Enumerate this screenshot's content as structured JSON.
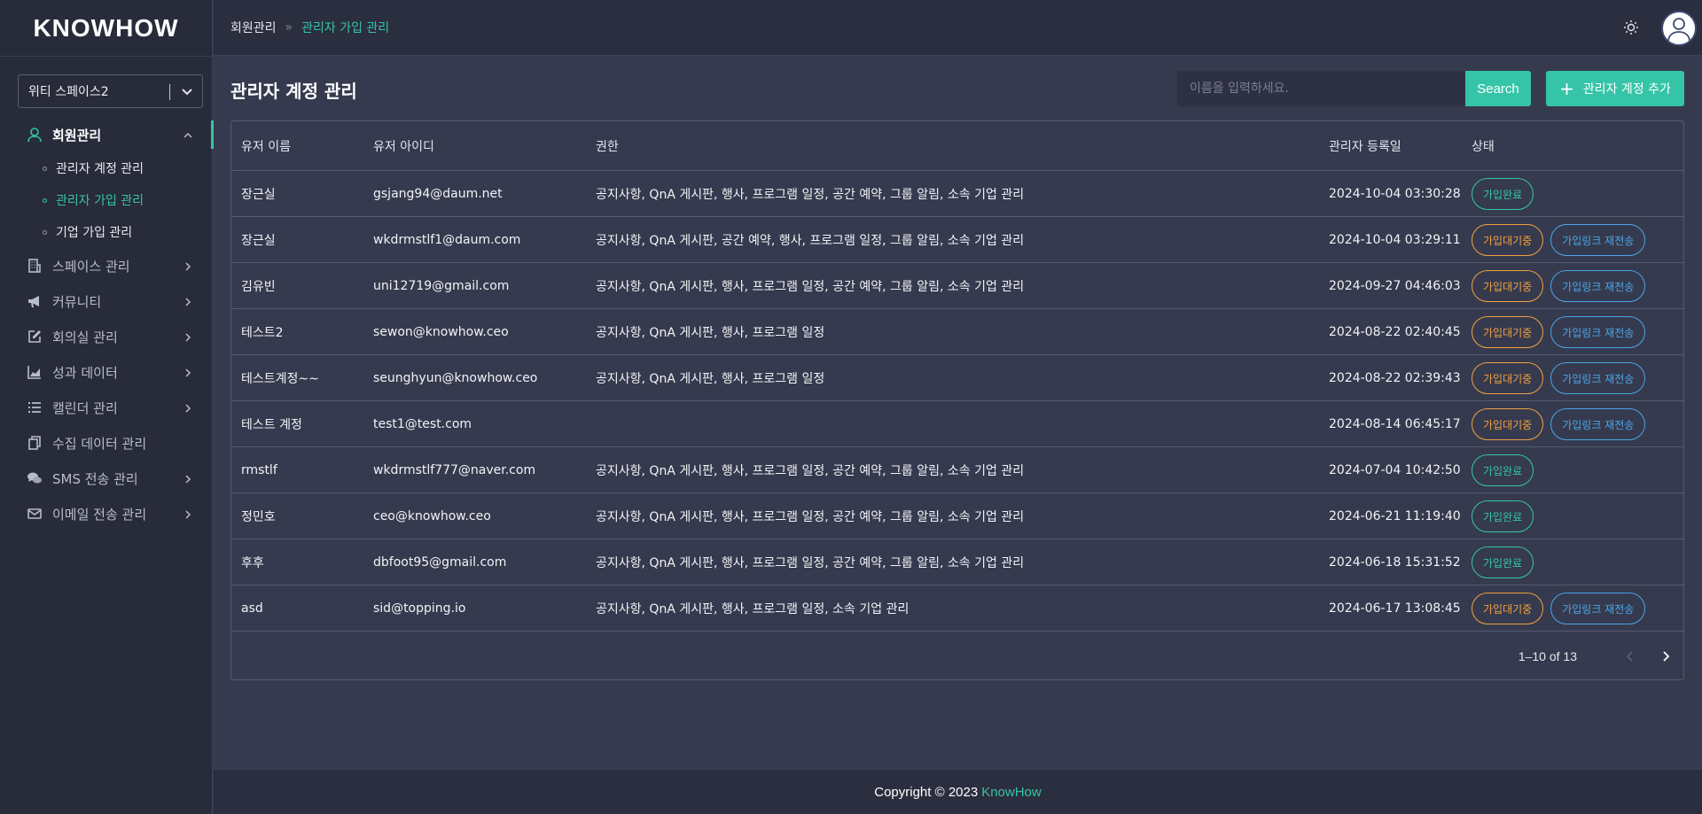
{
  "app": {
    "logo": "KNOWHOW"
  },
  "workspace": {
    "selected": "위티 스페이스2"
  },
  "sidebar": {
    "items": [
      {
        "label": "회원관리",
        "icon": "user-icon",
        "expanded": true
      },
      {
        "label": "스페이스 관리",
        "icon": "building-icon"
      },
      {
        "label": "커뮤니티",
        "icon": "megaphone-icon"
      },
      {
        "label": "회의실 관리",
        "icon": "edit-icon"
      },
      {
        "label": "성과 데이터",
        "icon": "area-chart-icon"
      },
      {
        "label": "캘린더 관리",
        "icon": "list-icon"
      },
      {
        "label": "수집 데이터 관리",
        "icon": "copy-icon"
      },
      {
        "label": "SMS 전송 관리",
        "icon": "chat-icon"
      },
      {
        "label": "이메일 전송 관리",
        "icon": "mail-icon"
      }
    ],
    "sub_items": [
      {
        "label": "관리자 계정 관리"
      },
      {
        "label": "관리자 가입 관리",
        "active": true
      },
      {
        "label": "기업 가입 관리"
      }
    ]
  },
  "header": {
    "breadcrumb_parent": "회원관리",
    "breadcrumb_separator": "»",
    "breadcrumb_current": "관리자 가입 관리"
  },
  "main": {
    "title": "관리자 계정 관리",
    "search_placeholder": "이름을 입력하세요.",
    "search_button": "Search",
    "add_button": "관리자 계정 추가"
  },
  "table": {
    "headers": [
      "유저 이름",
      "유저 아이디",
      "권한",
      "관리자 등록일",
      "상태"
    ],
    "rows": [
      {
        "name": "장근실",
        "id": "gsjang94@daum.net",
        "perm": "공지사항, QnA 게시판, 행사, 프로그램 일정, 공간 예약, 그룹 알림, 소속 기업 관리",
        "date": "2024-10-04 03:30:28",
        "status": "가입완료",
        "status_type": "done"
      },
      {
        "name": "장근실",
        "id": "wkdrmstlf1@daum.com",
        "perm": "공지사항, QnA 게시판, 공간 예약, 행사, 프로그램 일정, 그룹 알림, 소속 기업 관리",
        "date": "2024-10-04 03:29:11",
        "status": "가입대기중",
        "status_type": "wait",
        "resend": "가입링크 재전송"
      },
      {
        "name": "김유빈",
        "id": "uni12719@gmail.com",
        "perm": "공지사항, QnA 게시판, 행사, 프로그램 일정, 공간 예약, 그룹 알림, 소속 기업 관리",
        "date": "2024-09-27 04:46:03",
        "status": "가입대기중",
        "status_type": "wait",
        "resend": "가입링크 재전송"
      },
      {
        "name": "테스트2",
        "id": "sewon@knowhow.ceo",
        "perm": "공지사항, QnA 게시판, 행사, 프로그램 일정",
        "date": "2024-08-22 02:40:45",
        "status": "가입대기중",
        "status_type": "wait",
        "resend": "가입링크 재전송"
      },
      {
        "name": "테스트계정~~",
        "id": "seunghyun@knowhow.ceo",
        "perm": "공지사항, QnA 게시판, 행사, 프로그램 일정",
        "date": "2024-08-22 02:39:43",
        "status": "가입대기중",
        "status_type": "wait",
        "resend": "가입링크 재전송"
      },
      {
        "name": "테스트 계정",
        "id": "test1@test.com",
        "perm": "",
        "date": "2024-08-14 06:45:17",
        "status": "가입대기중",
        "status_type": "wait",
        "resend": "가입링크 재전송"
      },
      {
        "name": "rmstlf",
        "id": "wkdrmstlf777@naver.com",
        "perm": "공지사항, QnA 게시판, 행사, 프로그램 일정, 공간 예약, 그룹 알림, 소속 기업 관리",
        "date": "2024-07-04 10:42:50",
        "status": "가입완료",
        "status_type": "done"
      },
      {
        "name": "정민호",
        "id": "ceo@knowhow.ceo",
        "perm": "공지사항, QnA 게시판, 행사, 프로그램 일정, 공간 예약, 그룹 알림, 소속 기업 관리",
        "date": "2024-06-21 11:19:40",
        "status": "가입완료",
        "status_type": "done"
      },
      {
        "name": "후후",
        "id": "dbfoot95@gmail.com",
        "perm": "공지사항, QnA 게시판, 행사, 프로그램 일정, 공간 예약, 그룹 알림, 소속 기업 관리",
        "date": "2024-06-18 15:31:52",
        "status": "가입완료",
        "status_type": "done"
      },
      {
        "name": "asd",
        "id": "sid@topping.io",
        "perm": "공지사항, QnA 게시판, 행사, 프로그램 일정, 소속 기업 관리",
        "date": "2024-06-17 13:08:45",
        "status": "가입대기중",
        "status_type": "wait",
        "resend": "가입링크 재전송"
      }
    ],
    "pagination": {
      "range": "1–10 of 13"
    }
  },
  "footer": {
    "text": "Copyright © 2023",
    "brand": "KnowHow"
  },
  "colors": {
    "accent": "#35c4a8",
    "wait": "#f0a143",
    "resend": "#4aa5e6",
    "bg": "#363a4e",
    "sidebar": "#282b3a"
  }
}
